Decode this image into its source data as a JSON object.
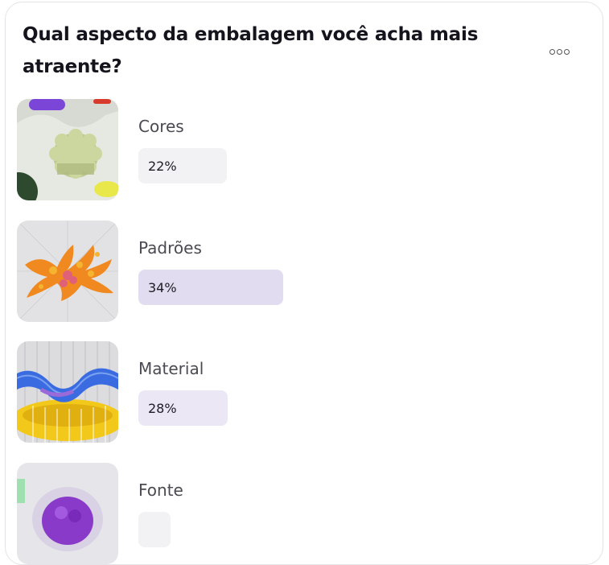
{
  "poll": {
    "question": "Qual aspecto da embalagem você acha mais atraente?",
    "options": [
      {
        "label": "Cores",
        "percent_text": "22%",
        "percent": 22,
        "bar_color": "#f2f2f4"
      },
      {
        "label": "Padrões",
        "percent_text": "34%",
        "percent": 34,
        "bar_color": "#e2dcf0"
      },
      {
        "label": "Material",
        "percent_text": "28%",
        "percent": 28,
        "bar_color": "#ebe7f5"
      },
      {
        "label": "Fonte",
        "percent_text": "",
        "percent": null,
        "bar_color": "#f2f2f4"
      }
    ]
  },
  "icons": {
    "menu": "more-options-icon"
  }
}
